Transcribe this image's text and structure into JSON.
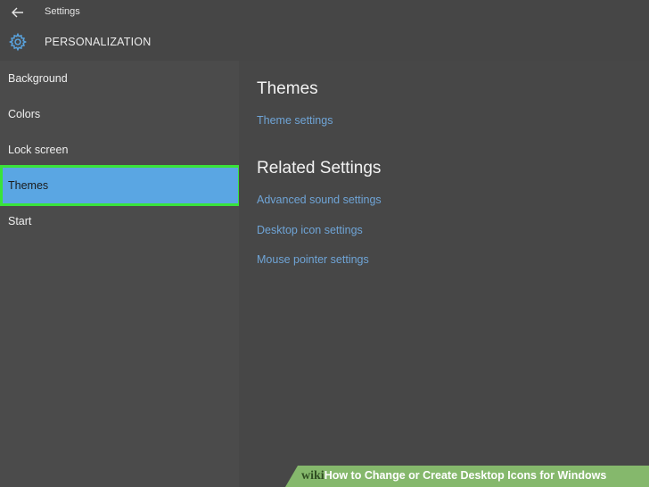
{
  "window": {
    "title": "Settings"
  },
  "header": {
    "title": "PERSONALIZATION",
    "icon": "gear-icon"
  },
  "sidebar": {
    "items": [
      {
        "label": "Background",
        "selected": false
      },
      {
        "label": "Colors",
        "selected": false
      },
      {
        "label": "Lock screen",
        "selected": false
      },
      {
        "label": "Themes",
        "selected": true
      },
      {
        "label": "Start",
        "selected": false
      }
    ]
  },
  "main": {
    "themes_title": "Themes",
    "theme_settings_link": "Theme settings",
    "related_title": "Related Settings",
    "related_links": [
      "Advanced sound settings",
      "Desktop icon settings",
      "Mouse pointer settings"
    ]
  },
  "footer": {
    "wiki": "wiki",
    "how": "How",
    "rest": " to Change or Create Desktop Icons for Windows"
  },
  "colors": {
    "selected_bg": "#5aa6e3",
    "selected_border": "#39e33a",
    "link": "#6fa4d6"
  }
}
